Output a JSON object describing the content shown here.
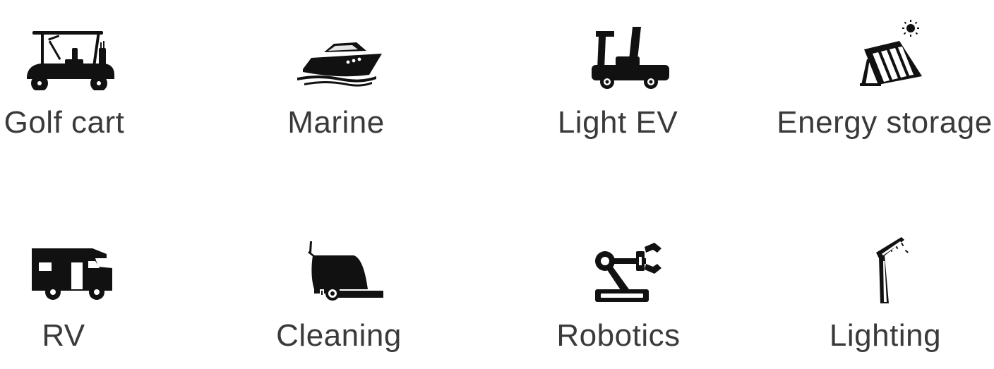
{
  "applications": [
    {
      "label": "Golf cart",
      "icon": "golf-cart-icon"
    },
    {
      "label": "Marine",
      "icon": "boat-icon"
    },
    {
      "label": "Light EV",
      "icon": "mobility-scooter-icon"
    },
    {
      "label": "Energy storage",
      "icon": "solar-panel-icon"
    },
    {
      "label": "RV",
      "icon": "rv-camper-icon"
    },
    {
      "label": "Cleaning",
      "icon": "floor-scrubber-icon"
    },
    {
      "label": "Robotics",
      "icon": "robotic-arm-icon"
    },
    {
      "label": "Lighting",
      "icon": "street-light-icon"
    }
  ],
  "colors": {
    "icon": "#111111",
    "label": "#3a3a3a",
    "background": "#ffffff"
  }
}
